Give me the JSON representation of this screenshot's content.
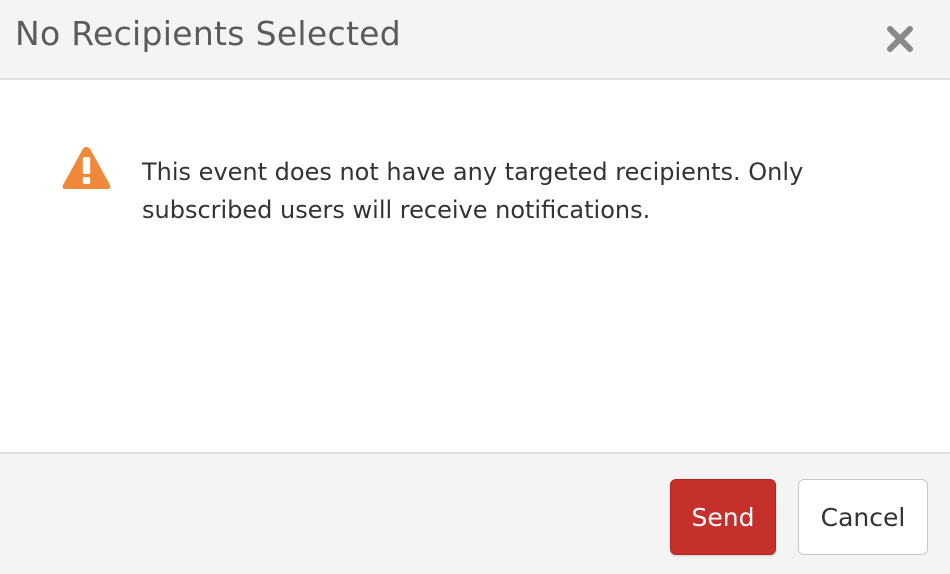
{
  "dialog": {
    "title": "No Recipients Selected",
    "close_icon": "close-icon",
    "warning_icon": "warning-triangle-icon",
    "message": "This event does not have any targeted recipients. Only subscribed users will receive notifications.",
    "buttons": {
      "send_label": "Send",
      "cancel_label": "Cancel"
    }
  },
  "colors": {
    "header_bg": "#f4f4f4",
    "warning": "#f0883a",
    "send_button": "#c5302a",
    "title_text": "#5b5b5b",
    "body_text": "#333333"
  }
}
